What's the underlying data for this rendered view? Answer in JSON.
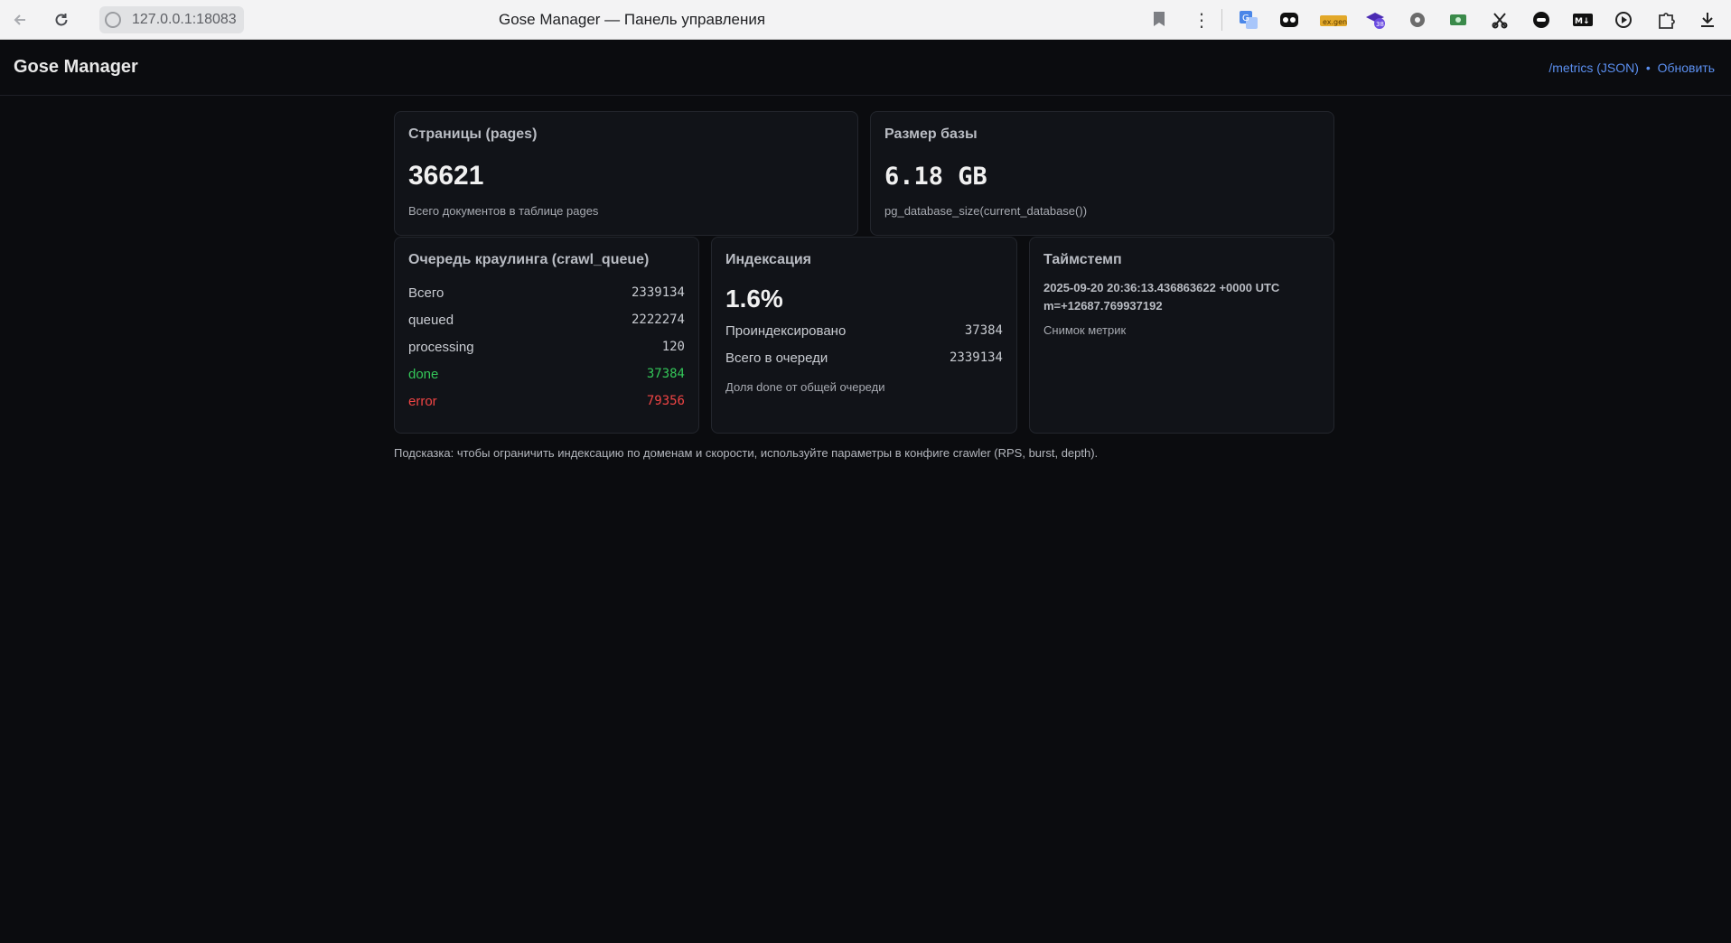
{
  "browser": {
    "url": "127.0.0.1:18083",
    "tab_title": "Gose Manager — Панель управления"
  },
  "header": {
    "title": "Gose Manager",
    "metrics_link": "/metrics (JSON)",
    "separator": "•",
    "refresh_link": "Обновить"
  },
  "pages_card": {
    "title": "Страницы (pages)",
    "value": "36621",
    "subtext": "Всего документов в таблице pages"
  },
  "db_card": {
    "title": "Размер базы",
    "value": "6.18 GB",
    "subtext": "pg_database_size(current_database())"
  },
  "queue_card": {
    "title": "Очередь краулинга (crawl_queue)",
    "rows": [
      {
        "label": "Всего",
        "value": "2339134"
      },
      {
        "label": "queued",
        "value": "2222274"
      },
      {
        "label": "processing",
        "value": "120"
      },
      {
        "label": "done",
        "value": "37384"
      },
      {
        "label": "error",
        "value": "79356"
      }
    ]
  },
  "indexing_card": {
    "title": "Индексация",
    "percent": "1.6%",
    "rows": [
      {
        "label": "Проиндексировано",
        "value": "37384"
      },
      {
        "label": "Всего в очереди",
        "value": "2339134"
      }
    ],
    "subtext": "Доля done от общей очереди"
  },
  "timestamp_card": {
    "title": "Таймстемп",
    "line1": "2025-09-20 20:36:13.436863622 +0000 UTC",
    "line2": "m=+12687.769937192",
    "subtext": "Снимок метрик"
  },
  "hint": "Подсказка: чтобы ограничить индексацию по доменам и скорости, используйте параметры в конфиге crawler (RPS, burst, depth).",
  "colors": {
    "done": "#34c759",
    "error": "#ef4444",
    "link": "#5b8ff0",
    "background": "#0b0c0f"
  }
}
